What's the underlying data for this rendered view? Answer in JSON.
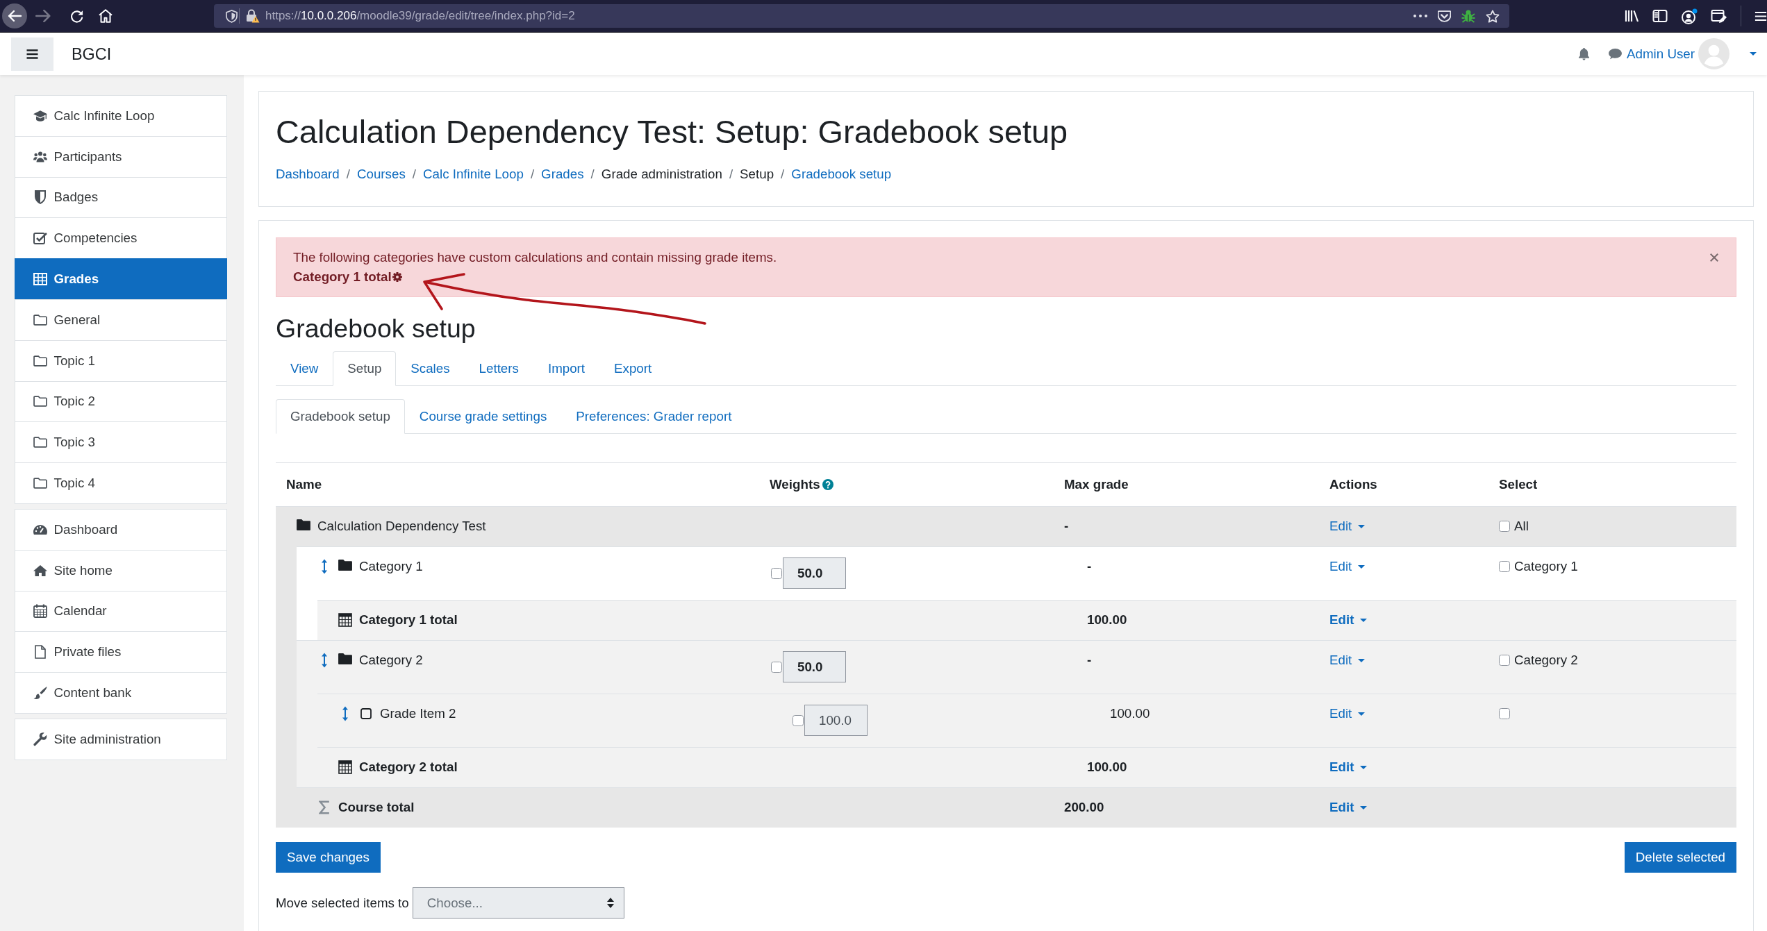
{
  "browser": {
    "forward": {
      "disabled": true
    },
    "url": {
      "scheme": "https://",
      "host": "10.0.0.206",
      "path": "/moodle39/grade/edit/tree/index.php?id=2"
    }
  },
  "navbar": {
    "brand": "BGCI",
    "user": "Admin User"
  },
  "sidebar": {
    "groups": [
      [
        {
          "label": "Calc Infinite Loop",
          "selected": false
        },
        {
          "label": "Participants",
          "selected": false
        },
        {
          "label": "Badges",
          "selected": false
        },
        {
          "label": "Competencies",
          "selected": false
        },
        {
          "label": "Grades",
          "selected": true
        },
        {
          "label": "General",
          "selected": false
        },
        {
          "label": "Topic 1",
          "selected": false
        },
        {
          "label": "Topic 2",
          "selected": false
        },
        {
          "label": "Topic 3",
          "selected": false
        },
        {
          "label": "Topic 4",
          "selected": false
        }
      ],
      [
        {
          "label": "Dashboard",
          "selected": false
        },
        {
          "label": "Site home",
          "selected": false
        },
        {
          "label": "Calendar",
          "selected": false
        },
        {
          "label": "Private files",
          "selected": false
        },
        {
          "label": "Content bank",
          "selected": false
        }
      ],
      [
        {
          "label": "Site administration",
          "selected": false
        }
      ]
    ]
  },
  "page_header": {
    "title": "Calculation Dependency Test: Setup: Gradebook setup",
    "breadcrumb": [
      {
        "label": "Dashboard",
        "link": true
      },
      {
        "separator": "/",
        "label": "Courses",
        "link": true
      },
      {
        "separator": "/",
        "label": "Calc Infinite Loop",
        "link": true
      },
      {
        "separator": "/",
        "label": "Grades",
        "link": true
      },
      {
        "separator": "/",
        "label": "Grade administration",
        "link": false
      },
      {
        "separator": "/",
        "label": "Setup",
        "link": false
      },
      {
        "separator": "/",
        "label": "Gradebook setup",
        "link": true
      }
    ]
  },
  "alert": {
    "message": "The following categories have custom calculations and contain missing grade items.",
    "items": [
      "Category 1 total"
    ]
  },
  "heading": "Gradebook setup",
  "tabs": [
    {
      "label": "View",
      "selected": false
    },
    {
      "label": "Setup",
      "selected": true
    },
    {
      "label": "Scales",
      "selected": false
    },
    {
      "label": "Letters",
      "selected": false
    },
    {
      "label": "Import",
      "selected": false
    },
    {
      "label": "Export",
      "selected": false
    }
  ],
  "subtabs": [
    {
      "label": "Gradebook setup",
      "selected": true
    },
    {
      "label": "Course grade settings",
      "selected": false
    },
    {
      "label": "Preferences: Grader report",
      "selected": false
    }
  ],
  "table": {
    "columns": [
      {
        "label": "Name",
        "help": false
      },
      {
        "label": "Weights",
        "help": true
      },
      {
        "label": "Max grade",
        "help": false
      },
      {
        "label": "Actions",
        "help": false
      },
      {
        "label": "Select",
        "help": false
      }
    ],
    "rows": [
      {
        "kind": "category",
        "name": "Calculation Dependency Test",
        "max_grade": "-",
        "action": "Edit",
        "checked": false,
        "select_label": "All",
        "children": [
          {
            "kind": "category",
            "name": "Category 1",
            "weight": "50.0",
            "weight_override": false,
            "max_grade": "-",
            "action": "Edit",
            "checked": false,
            "select_label": "Category 1",
            "children": [
              {
                "kind": "total",
                "name": "Category 1 total",
                "max_grade": "100.00",
                "action": "Edit"
              }
            ]
          },
          {
            "kind": "category",
            "name": "Category 2",
            "weight": "50.0",
            "weight_override": false,
            "max_grade": "-",
            "action": "Edit",
            "checked": false,
            "select_label": "Category 2",
            "children": [
              {
                "kind": "item",
                "name": "Grade Item 2",
                "weight": "100.0",
                "weight_override": false,
                "max_grade": "100.00",
                "action": "Edit",
                "checked": false
              },
              {
                "kind": "total",
                "name": "Category 2 total",
                "max_grade": "100.00",
                "action": "Edit"
              }
            ]
          },
          {
            "kind": "course_total",
            "name": "Course total",
            "max_grade": "200.00",
            "action": "Edit"
          }
        ]
      }
    ]
  },
  "footer": {
    "save_button": "Save changes",
    "delete_button": "Delete selected",
    "move_label": "Move selected items to",
    "move_select": {
      "value": "Choose...",
      "disabled": true
    }
  }
}
